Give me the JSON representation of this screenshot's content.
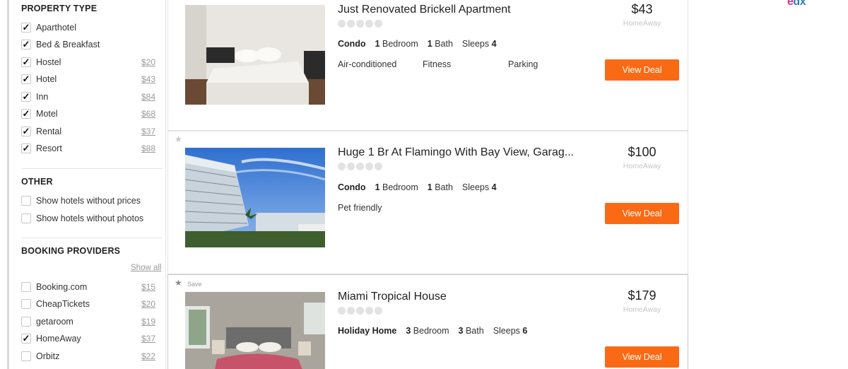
{
  "filters": {
    "property_type": {
      "title": "PROPERTY TYPE",
      "items": [
        {
          "label": "Aparthotel",
          "checked": true,
          "price": ""
        },
        {
          "label": "Bed & Breakfast",
          "checked": true,
          "price": ""
        },
        {
          "label": "Hostel",
          "checked": true,
          "price": "$20"
        },
        {
          "label": "Hotel",
          "checked": true,
          "price": "$43"
        },
        {
          "label": "Inn",
          "checked": true,
          "price": "$84"
        },
        {
          "label": "Motel",
          "checked": true,
          "price": "$68"
        },
        {
          "label": "Rental",
          "checked": true,
          "price": "$37"
        },
        {
          "label": "Resort",
          "checked": true,
          "price": "$88"
        }
      ]
    },
    "other": {
      "title": "OTHER",
      "items": [
        {
          "label": "Show hotels without prices",
          "checked": false
        },
        {
          "label": "Show hotels without photos",
          "checked": false
        }
      ]
    },
    "booking_providers": {
      "title": "BOOKING PROVIDERS",
      "show_all": "Show all",
      "items": [
        {
          "label": "Booking.com",
          "checked": false,
          "price": "$15"
        },
        {
          "label": "CheapTickets",
          "checked": false,
          "price": "$20"
        },
        {
          "label": "getaroom",
          "checked": false,
          "price": "$19"
        },
        {
          "label": "HomeAway",
          "checked": true,
          "price": "$37"
        },
        {
          "label": "Orbitz",
          "checked": false,
          "price": "$22"
        }
      ]
    }
  },
  "listings": [
    {
      "title": "Just Renovated Brickell Apartment",
      "rating_dots": 5,
      "type": "Condo",
      "bedrooms": "1",
      "bedroom_label": "Bedroom",
      "baths": "1",
      "bath_label": "Bath",
      "sleeps_label": "Sleeps",
      "sleeps": "4",
      "amenities": [
        "Air-conditioned",
        "Fitness",
        "Parking"
      ],
      "price": "$43",
      "provider": "HomeAway",
      "cta": "View Deal",
      "save_label": ""
    },
    {
      "title": "Huge 1 Br At Flamingo With Bay View, Garag...",
      "rating_dots": 5,
      "type": "Condo",
      "bedrooms": "1",
      "bedroom_label": "Bedroom",
      "baths": "1",
      "bath_label": "Bath",
      "sleeps_label": "Sleeps",
      "sleeps": "4",
      "amenities": [
        "Pet friendly"
      ],
      "price": "$100",
      "provider": "HomeAway",
      "cta": "View Deal",
      "save_label": ""
    },
    {
      "title": "Miami Tropical House",
      "rating_dots": 5,
      "type": "Holiday Home",
      "bedrooms": "3",
      "bedroom_label": "Bedroom",
      "baths": "3",
      "bath_label": "Bath",
      "sleeps_label": "Sleeps",
      "sleeps": "6",
      "amenities": [],
      "price": "$179",
      "provider": "HomeAway",
      "cta": "View Deal",
      "save_label": "Save"
    }
  ],
  "logo": {
    "text_e": "e",
    "text_d": "d",
    "text_x": "x"
  },
  "icons": {
    "star": "star-icon",
    "checkmark": "check-icon"
  },
  "colors": {
    "cta": "#fa6a14",
    "divider": "#e5e5e5"
  }
}
